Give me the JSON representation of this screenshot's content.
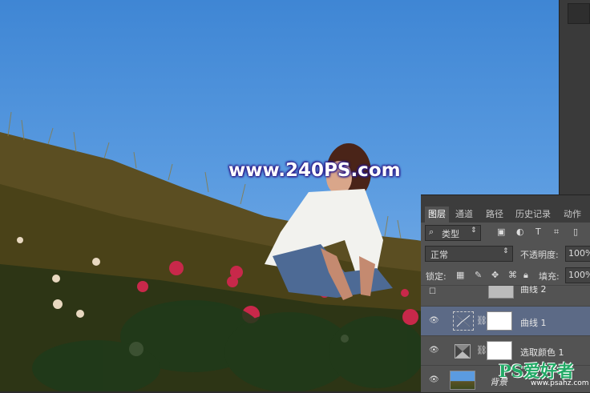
{
  "watermark": "www.240PS.com",
  "layers_panel": {
    "tabs": [
      "图层",
      "通道",
      "路径",
      "历史记录",
      "动作"
    ],
    "filter_kind": "类型",
    "blend_mode": "正常",
    "opacity_label": "不透明度:",
    "opacity_value": "100%",
    "lock_label": "锁定:",
    "fill_label": "填充:",
    "fill_value": "100%",
    "layers": [
      {
        "name": "曲线 2",
        "visible": false
      },
      {
        "name": "曲线 1",
        "visible": true,
        "selected": true
      },
      {
        "name": "选取颜色 1",
        "visible": true
      },
      {
        "name": "背景",
        "visible": true
      }
    ]
  },
  "site_logo": {
    "text": "PS爱好者",
    "url": "www.psahz.com"
  },
  "colors": {
    "panel_bg": "#535353",
    "selected_row": "#5c6a86",
    "sky": "#4a8fd8"
  }
}
